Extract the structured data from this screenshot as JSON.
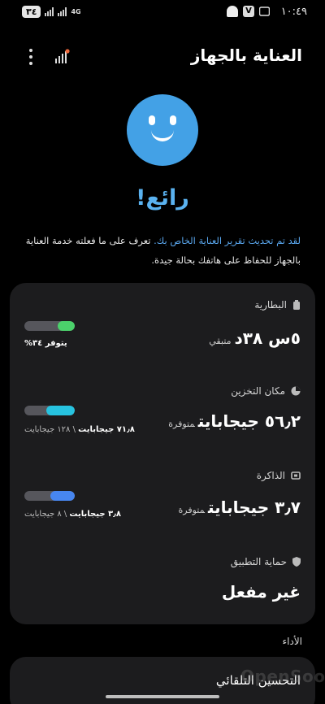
{
  "status_bar": {
    "time": "١٠:٤٩",
    "battery": "٣٤",
    "network": "4G",
    "right_icons": [
      "snapchat-icon",
      "v-app-icon",
      "message-icon"
    ]
  },
  "header": {
    "title": "العناية بالجهاز",
    "menu_icon": "more-vertical-icon",
    "report_icon": "signal-bars-icon"
  },
  "hero": {
    "emoji": "smiley-face-icon",
    "title": "رائع!",
    "summary_link": "لقد تم تحديث تقرير العناية الخاص بك.",
    "summary_rest": " تعرف على ما فعلته خدمة العناية بالجهاز للحفاظ على هاتفك بحالة جيدة."
  },
  "sections": {
    "battery": {
      "label": "البطارية",
      "icon": "battery-icon",
      "value": "٥س ٣٨د",
      "value_suffix": "متبقي",
      "sub": "يتوفر ٣٤%",
      "fill_fraction": 0.34,
      "fill_color": "#4bd16b"
    },
    "storage": {
      "label": "مكان التخزين",
      "icon": "pie-chart-icon",
      "value": "٥٦٫٢ جيجابايت",
      "value_suffix": "متوفرة",
      "sub_used": "٧١٫٨ جيجابايت",
      "sub_total": " \\ ١٢٨ جيجابايت",
      "fill_fraction": 0.56,
      "fill_color": "#27c3e0"
    },
    "memory": {
      "label": "الذاكرة",
      "icon": "memory-chip-icon",
      "value": "٣٫٧ جيجابايت",
      "value_suffix": "متوفرة",
      "sub_used": "٣٫٨ جيجابايت",
      "sub_total": " \\ ٨ جيجابايت",
      "fill_fraction": 0.48,
      "fill_color": "#4786f0"
    },
    "app_protection": {
      "label": "حماية التطبيق",
      "icon": "shield-icon",
      "value": "غير مفعل"
    }
  },
  "performance": {
    "label": "الأداء",
    "item": "التحسين التلقائي"
  },
  "watermark": "OpenSooq"
}
